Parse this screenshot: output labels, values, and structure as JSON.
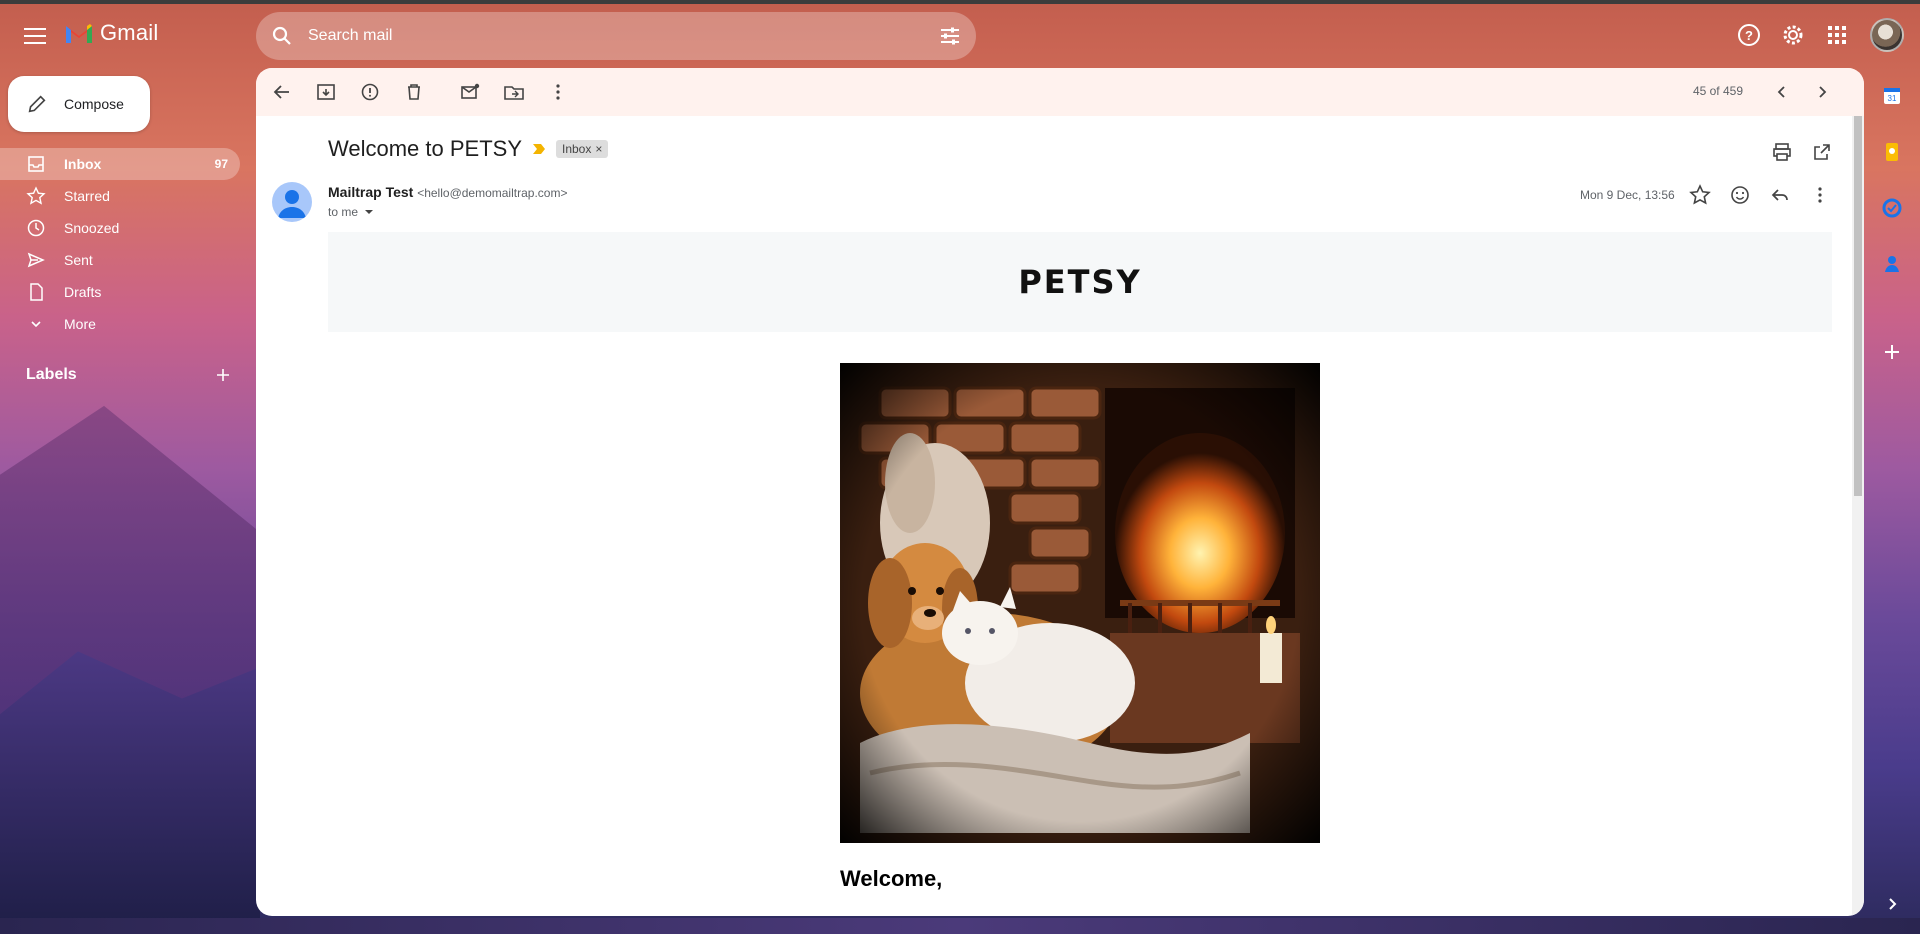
{
  "app": {
    "name": "Gmail"
  },
  "search": {
    "placeholder": "Search mail"
  },
  "compose": {
    "label": "Compose"
  },
  "nav": [
    {
      "label": "Inbox",
      "count": "97",
      "icon": "inbox-icon"
    },
    {
      "label": "Starred",
      "count": "",
      "icon": "star-icon"
    },
    {
      "label": "Snoozed",
      "count": "",
      "icon": "clock-icon"
    },
    {
      "label": "Sent",
      "count": "",
      "icon": "send-icon"
    },
    {
      "label": "Drafts",
      "count": "",
      "icon": "draft-icon"
    },
    {
      "label": "More",
      "count": "",
      "icon": "chevron-down-icon"
    }
  ],
  "labels": {
    "title": "Labels"
  },
  "pager": {
    "text": "45 of 459"
  },
  "email": {
    "subject": "Welcome to PETSY",
    "label_chip": "Inbox",
    "sender_name": "Mailtrap Test",
    "sender_email": "<hello@demomailtrap.com>",
    "recipient": "to me",
    "date": "Mon 9 Dec, 13:56",
    "brand": "PETSY",
    "greeting": "Welcome,"
  },
  "colors": {
    "accent": "#1a73e8",
    "important": "#f4b400",
    "panel": "#ffffff"
  }
}
